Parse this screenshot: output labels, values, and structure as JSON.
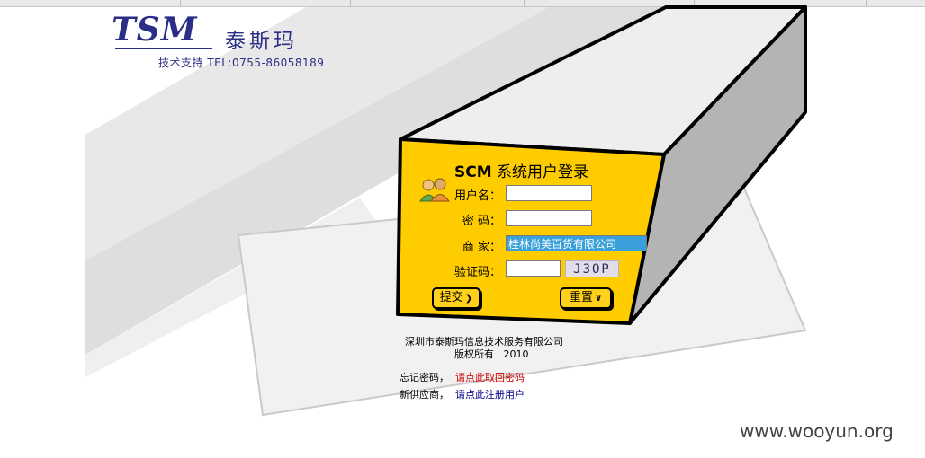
{
  "logo": {
    "mark": "TSM",
    "name_cn": "泰斯玛",
    "support": "技术支持 TEL:0755-86058189"
  },
  "login": {
    "title_bold": "SCM",
    "title_rest": " 系统用户登录",
    "username_label": "用户名：",
    "username_value": "",
    "password_label": "密 码：",
    "password_value": "",
    "merchant_label": "商 家：",
    "merchant_value": "桂林尚美百货有限公司",
    "captcha_label": "验证码：",
    "captcha_value": "",
    "captcha_code": "J3OP",
    "submit_label": "提交",
    "reset_label": "重置"
  },
  "footer": {
    "company": "深圳市泰斯玛信息技术服务有限公司",
    "copyright": "版权所有",
    "year": "2010",
    "forgot_prefix": "忘记密码，",
    "forgot_link": "请点此取回密码",
    "register_prefix": "新供应商，",
    "register_link": "请点此注册用户"
  },
  "watermark": "www.wooyun.org",
  "colors": {
    "panel": "#ffcc00",
    "logo": "#2b2e86",
    "link_red": "#cc0000",
    "link_blue": "#000088"
  }
}
